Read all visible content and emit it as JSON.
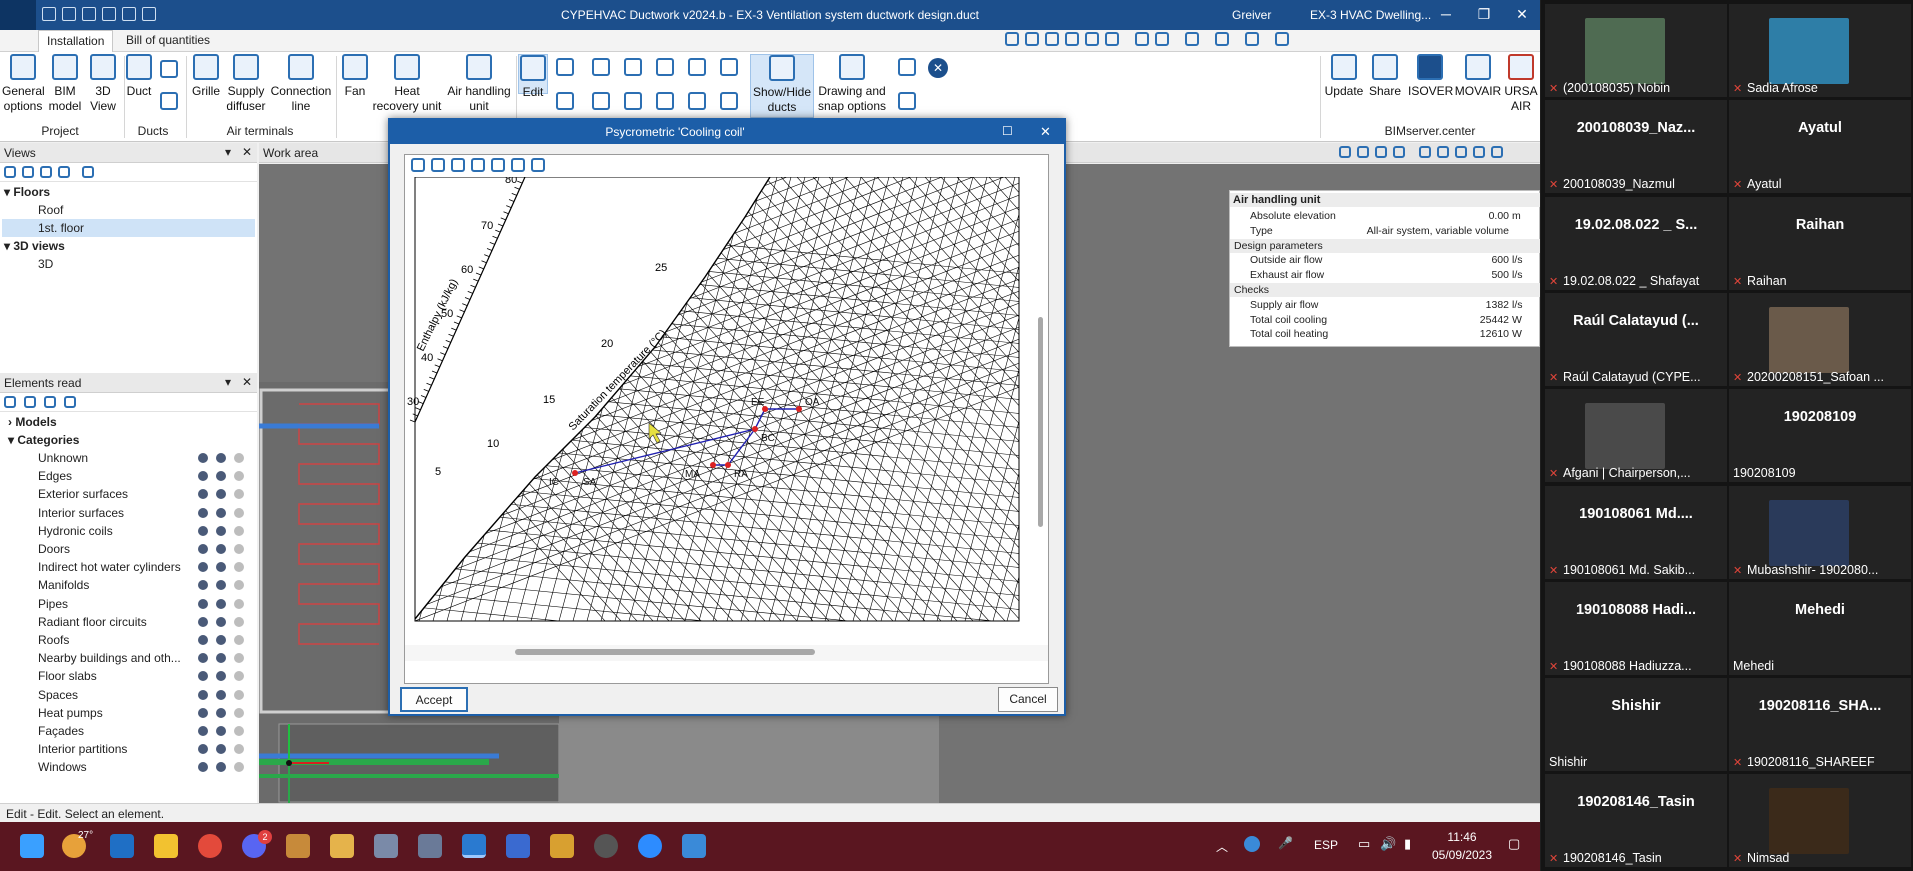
{
  "app": {
    "title": "CYPEHVAC Ductwork v2024.b - EX-3 Ventilation system ductwork design.duct",
    "user": "Greiver",
    "project_tab": "EX-3 HVAC Dwelling...",
    "win_min": "─",
    "win_max": "❐",
    "win_close": "✕"
  },
  "tabs": [
    "Installation",
    "Bill of quantities"
  ],
  "ribbon": {
    "buttons": [
      {
        "label": "General options",
        "icon": "gear-icon"
      },
      {
        "label": "BIM model",
        "icon": "bim-model-icon"
      },
      {
        "label": "3D View",
        "icon": "3d-view-icon"
      },
      {
        "label": "Duct",
        "icon": "duct-icon"
      },
      {
        "label": "Grille",
        "icon": "grille-icon"
      },
      {
        "label": "Supply diffuser",
        "icon": "diffuser-icon"
      },
      {
        "label": "Connection line",
        "icon": "connection-line-icon"
      },
      {
        "label": "Fan",
        "icon": "fan-icon"
      },
      {
        "label": "Heat recovery unit",
        "icon": "heat-recovery-icon"
      },
      {
        "label": "Air handling unit",
        "icon": "air-handling-icon"
      },
      {
        "label": "Edit",
        "icon": "edit-icon"
      },
      {
        "label": "Show/Hide ducts",
        "icon": "show-hide-icon"
      },
      {
        "label": "Drawing and snap options",
        "icon": "drawing-snap-icon"
      },
      {
        "label": "Update",
        "icon": "update-icon"
      },
      {
        "label": "Share",
        "icon": "share-icon"
      },
      {
        "label": "ISOVER",
        "icon": "isover-icon"
      },
      {
        "label": "MOVAIR",
        "icon": "movair-icon"
      },
      {
        "label": "URSA AIR",
        "icon": "ursa-icon"
      }
    ],
    "groups": {
      "project": "Project",
      "ducts": "Ducts",
      "air_terminals": "Air terminals",
      "bimserver": "BIMserver.center"
    }
  },
  "views": {
    "title": "Views",
    "items": [
      {
        "label": "Floors",
        "bold": true,
        "expander": "▾"
      },
      {
        "label": "Roof"
      },
      {
        "label": "1st. floor",
        "selected": true
      },
      {
        "label": "3D views",
        "bold": true,
        "expander": "▾"
      },
      {
        "label": "3D"
      }
    ]
  },
  "elements": {
    "title": "Elements read",
    "models": "Models",
    "categories": "Categories",
    "items": [
      "Unknown",
      "Edges",
      "Exterior surfaces",
      "Interior surfaces",
      "Hydronic coils",
      "Doors",
      "Indirect hot water cylinders",
      "Manifolds",
      "Pipes",
      "Radiant floor circuits",
      "Roofs",
      "Nearby buildings and oth...",
      "Floor slabs",
      "Spaces",
      "Heat pumps",
      "Façades",
      "Interior partitions",
      "Windows"
    ]
  },
  "work_area": {
    "title": "Work area"
  },
  "status": "Edit - Edit. Select an element.",
  "properties": {
    "title": "Air handling unit",
    "rows": [
      {
        "label": "Absolute elevation",
        "value": "0.00",
        "unit": "m"
      },
      {
        "label": "Type",
        "value": "All-air system, variable volume",
        "unit": ""
      },
      {
        "section": "Design parameters"
      },
      {
        "label": "Outside air flow",
        "value": "600",
        "unit": "l/s"
      },
      {
        "label": "Exhaust air flow",
        "value": "500",
        "unit": "l/s"
      },
      {
        "section": "Checks"
      },
      {
        "label": "Supply air flow",
        "value": "1382",
        "unit": "l/s"
      },
      {
        "label": "Total coil cooling",
        "value": "25442",
        "unit": "W"
      },
      {
        "label": "Total coil heating",
        "value": "12610",
        "unit": "W"
      }
    ]
  },
  "dialog": {
    "title": "Psycrometric 'Cooling coil'",
    "accept": "Accept",
    "cancel": "Cancel",
    "chart": {
      "enthalpy_label": "Enthalpy (kJ/kg)",
      "saturation_label": "Saturation temperature (°C)",
      "enthalpy_ticks": [
        "80",
        "70",
        "60",
        "50",
        "40",
        "30"
      ],
      "saturation_ticks": [
        "25",
        "20",
        "15",
        "10",
        "5"
      ],
      "points": [
        "EE",
        "OA",
        "BC",
        "RA",
        "MA",
        "SA",
        "IC"
      ]
    }
  },
  "taskbar": {
    "weather": "27°",
    "lang": "ESP",
    "time": "11:46",
    "date": "05/09/2023",
    "notification_count": "2"
  },
  "participants": [
    {
      "name": "",
      "label": "(200108035) Nobin",
      "thumb": "#4f6b52"
    },
    {
      "name": "",
      "label": "Sadia Afrose",
      "thumb": "#2e7ea7"
    },
    {
      "name": "200108039_Naz...",
      "label": "200108039_Nazmul"
    },
    {
      "name": "Ayatul",
      "label": "Ayatul"
    },
    {
      "name": "19.02.08.022 _ S...",
      "label": "19.02.08.022 _ Shafayat"
    },
    {
      "name": "Raihan",
      "label": "Raihan"
    },
    {
      "name": "Raúl Calatayud (...",
      "label": "Raúl Calatayud (CYPE..."
    },
    {
      "name": "",
      "label": "20200208151_Safoan ...",
      "thumb": "#6a5a4a"
    },
    {
      "name": "",
      "label": "Afgani | Chairperson,...",
      "thumb": "#4a4a4a"
    },
    {
      "name": "190208109",
      "label": "190208109"
    },
    {
      "name": "190108061 Md....",
      "label": "190108061 Md. Sakib..."
    },
    {
      "name": "",
      "label": "Mubashshir- 1902080...",
      "thumb": "#2a3a5a"
    },
    {
      "name": "190108088 Hadi...",
      "label": "190108088 Hadiuzza..."
    },
    {
      "name": "Mehedi",
      "label": "Mehedi"
    },
    {
      "name": "Shishir",
      "label": "Shishir"
    },
    {
      "name": "190208116_SHA...",
      "label": "190208116_SHAREEF"
    },
    {
      "name": "190208146_Tasin",
      "label": "190208146_Tasin"
    },
    {
      "name": "",
      "label": "Nimsad",
      "thumb": "#3b2a1a"
    }
  ]
}
